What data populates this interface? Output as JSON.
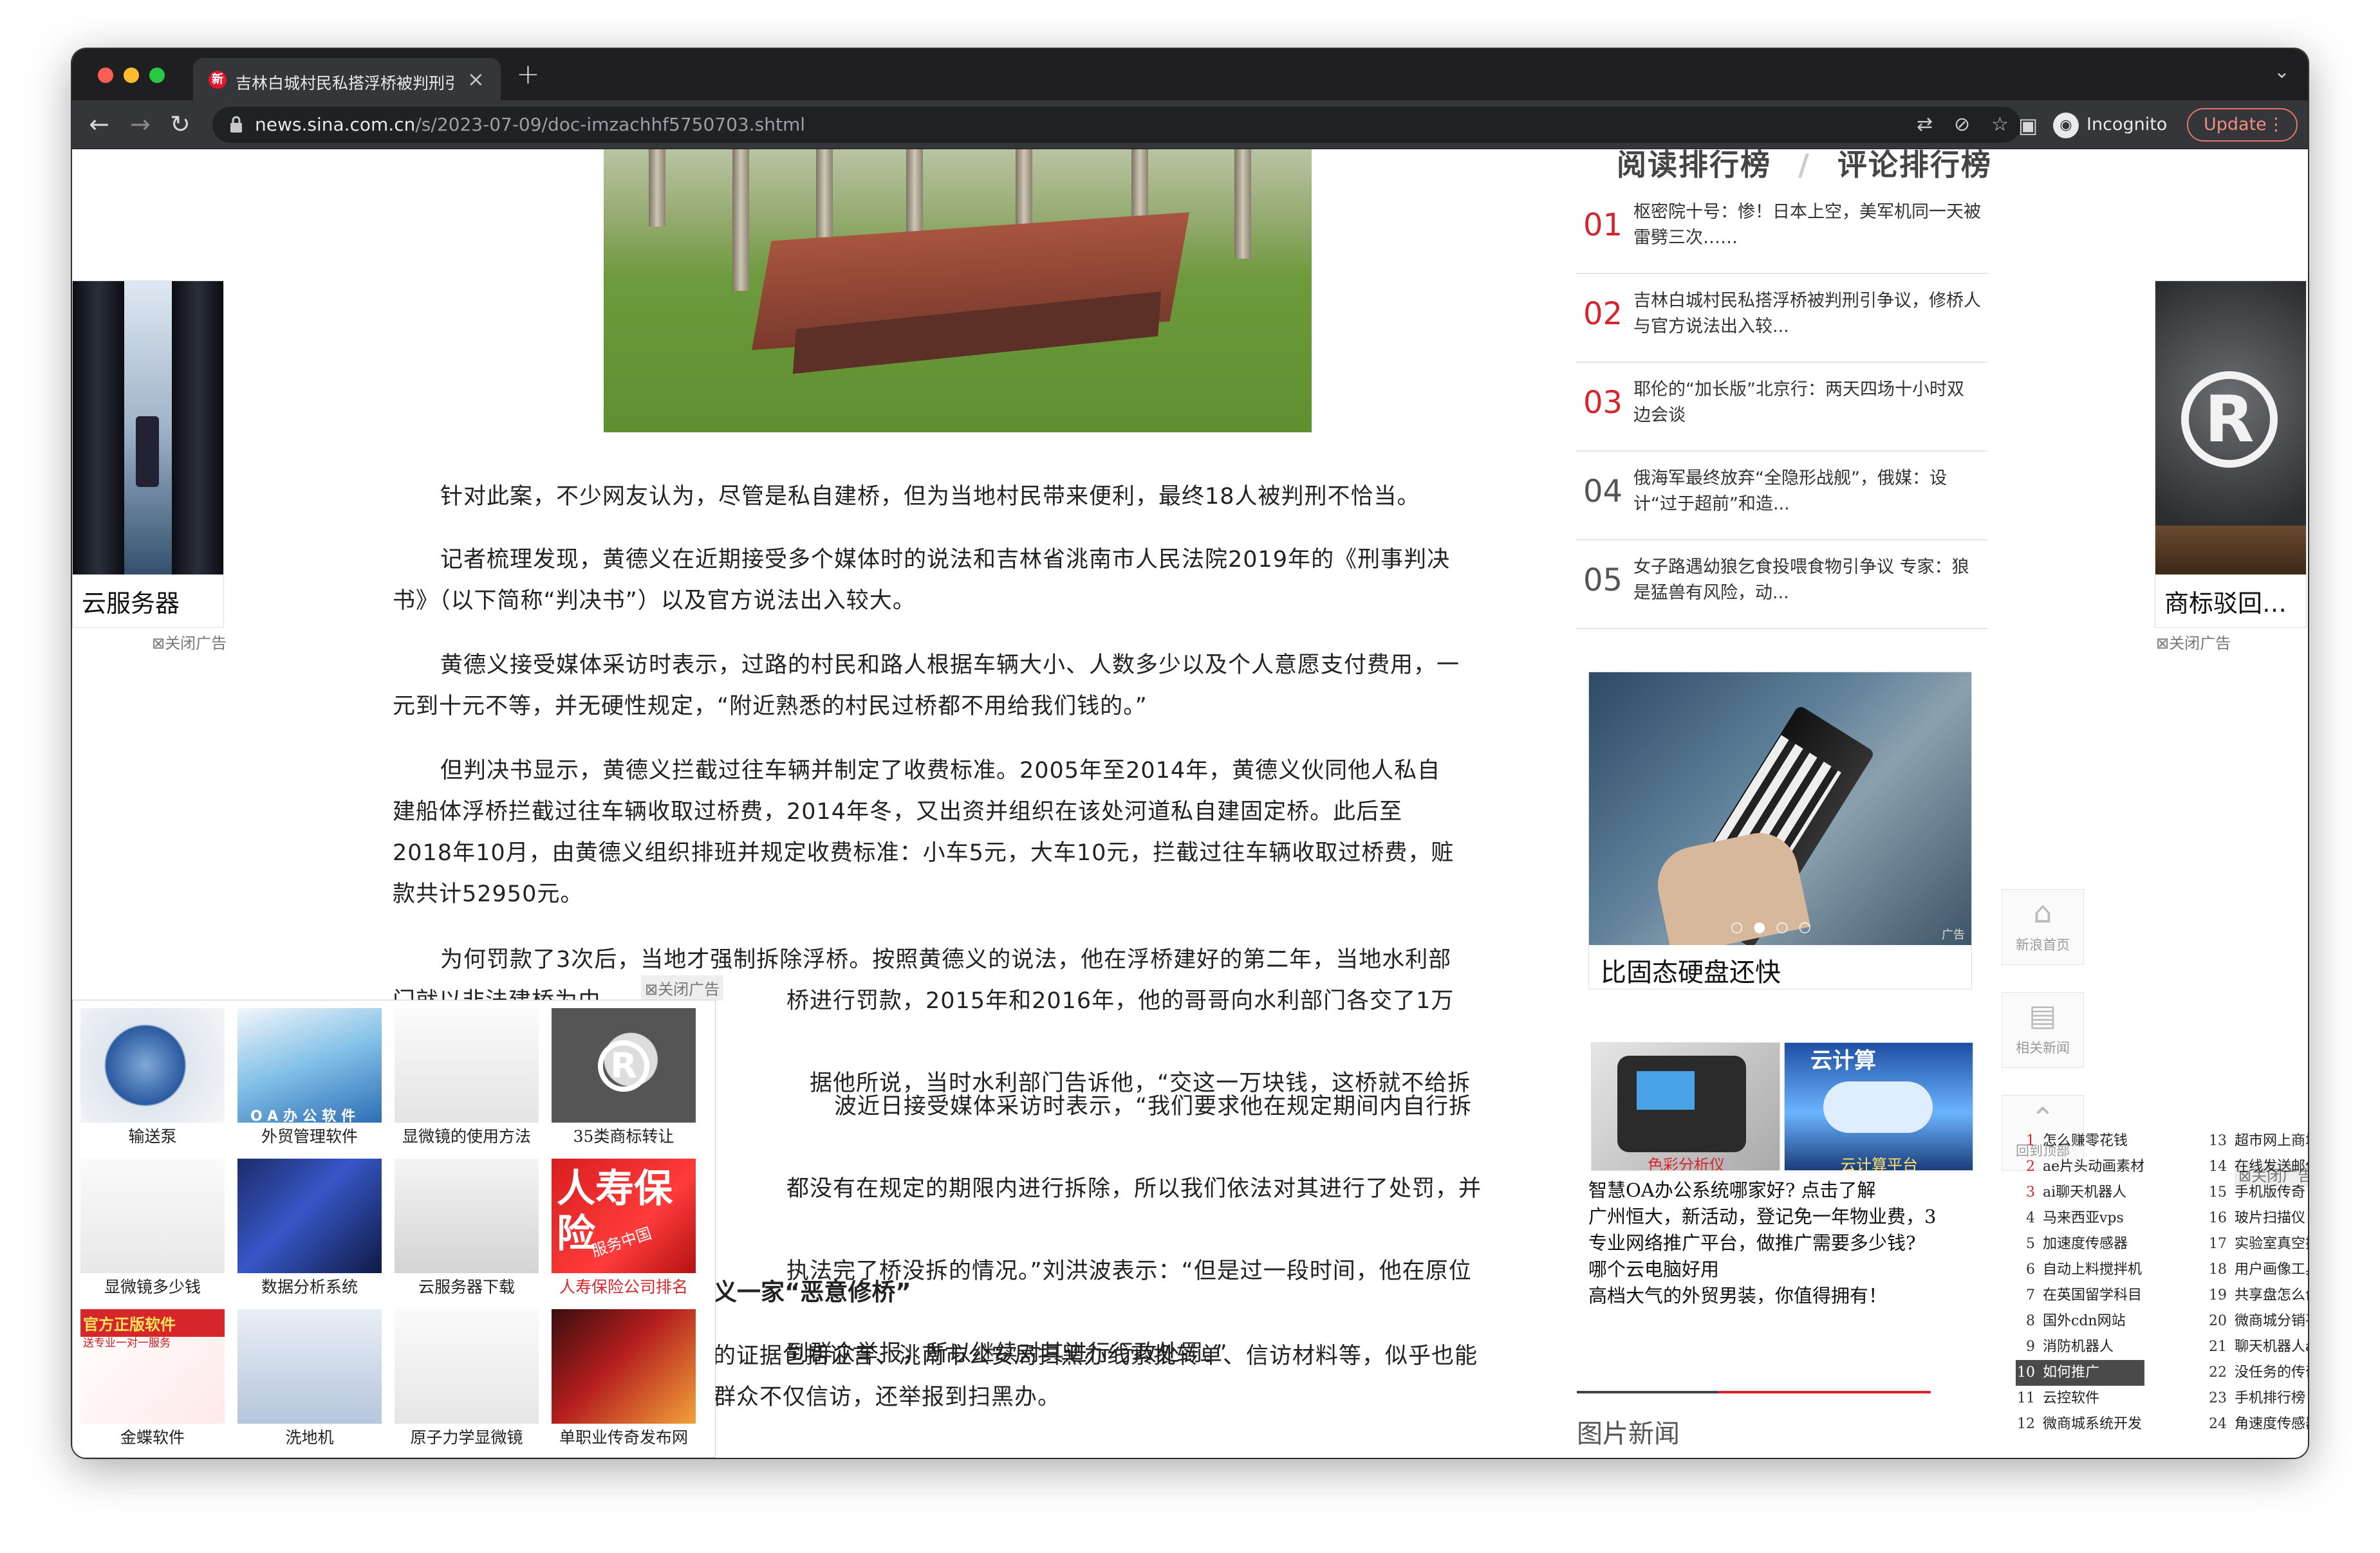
{
  "browser": {
    "tab_title": "吉林白城村民私搭浮桥被判刑引",
    "tab_icon_text": "新",
    "url_host": "news.sina.com.cn",
    "url_path": "/s/2023-07-09/doc-imzachhf5750703.shtml",
    "profile": "Incognito",
    "update_label": "Update",
    "icons": [
      "back-icon",
      "forward-icon",
      "reload-icon",
      "lock-icon",
      "translate-icon",
      "eye-off-icon",
      "star-icon",
      "sidepanel-icon",
      "incognito-icon",
      "more-icon"
    ]
  },
  "article": {
    "paragraphs": [
      [
        "针对此案，不少网友认为，尽管是私自建桥，但为当地村民带来便利，最终18人被判刑不恰当。"
      ],
      [
        "记者梳理发现，黄德义在近期接受多个媒体时的说法和吉林省洮南市人民法院2019年的《刑事判决",
        "书》（以下简称“判决书”）以及官方说法出入较大。"
      ],
      [
        "黄德义接受媒体采访时表示，过路的村民和路人根据车辆大小、人数多少以及个人意愿支付费用，一",
        "元到十元不等，并无硬性规定，“附近熟悉的村民过桥都不用给我们钱的。”"
      ],
      [
        "但判决书显示，黄德义拦截过往车辆并制定了收费标准。2005年至2014年，黄德义伙同他人私自",
        "建船体浮桥拦截过往车辆收取过桥费，2014年冬，又出资并组织在该处河道私自建固定桥。此后至",
        "2018年10月，由黄德义组织排班并规定收费标准：小车5元，大车10元，拦截过往车辆收取过桥费，赃",
        "款共计52950元。"
      ],
      [
        "为何罚款了3次后，当地才强制拆除浮桥。按照黄德义的说法，他在浮桥建好的第二年，当地水利部",
        "门就以非法建桥为由　　　　　　　　桥进行罚款，2015年和2016年，他的哥哥向水利部门各交了1万元。",
        "　　　　　　　　　　　　　　　　　　据他所说，当时水利部门告诉他，“交这一万块钱，这桥就不给拆了”。"
      ],
      [
        "　　　　　　　　　　　　　　　　　波近日接受媒体采访时表示，“我们要求他在规定期间内自行拆除违法建筑",
        "　　　　　　　　　　　　　　　　　都没有在规定的期限内进行拆除，所以我们依法对其进行了处罚，并且每次",
        "　　　　　　　　　　　　　　　　　执法完了桥没拆的情况。”刘洪波表示：“但是过一段时间，他在原位置上",
        "　　　　　　　　　　　　　　　　　到群众举报，所以继续对其进行行政处罚。”"
      ]
    ],
    "subheading": "义一家“恶意修桥”",
    "tail_lines": [
      "的证据包括证言、洮南市公安局扫黑办线索批转单、信访材料等，似乎也能",
      "群众不仅信访，还举报到扫黑办。"
    ]
  },
  "left_ad": {
    "caption": "云服务器",
    "close": "⊠关闭广告"
  },
  "right_ad": {
    "caption": "商标驳回…",
    "close": "⊠关闭广告"
  },
  "grid_ad": {
    "close": "⊠关闭广告",
    "items": [
      {
        "label": "输送泵"
      },
      {
        "label": "外贸管理软件"
      },
      {
        "label": "显微镜的使用方法"
      },
      {
        "label": "35类商标转让"
      },
      {
        "label": "显微镜多少钱"
      },
      {
        "label": "数据分析系统"
      },
      {
        "label": "云服务器下载"
      },
      {
        "label": "人寿保险公司排名"
      },
      {
        "label": "金蝶软件"
      },
      {
        "label": "洗地机"
      },
      {
        "label": "原子力学显微镜"
      },
      {
        "label": "单职业传奇发布网"
      }
    ],
    "oa_text": "OA办公软件",
    "insurance_text": "人寿保险",
    "insurance_sub": "服务中国",
    "kingdee_text": "官方正版软件",
    "kingdee_sub": "送专业一对一服务"
  },
  "ranking": {
    "tabs": [
      "阅读排行榜",
      "评论排行榜"
    ],
    "items": [
      {
        "num": "01",
        "text": "枢密院十号：惨！日本上空，美军机同一天被雷劈三次……"
      },
      {
        "num": "02",
        "text": "吉林白城村民私搭浮桥被判刑引争议，修桥人与官方说法出入较..."
      },
      {
        "num": "03",
        "text": "耶伦的“加长版”北京行：两天四场十小时双边会谈"
      },
      {
        "num": "04",
        "text": "俄海军最终放弃“全隐形战舰”，俄媒：设计“过于超前”和造..."
      },
      {
        "num": "05",
        "text": "女子路遇幼狼乞食投喂食物引争议 专家：狼是猛兽有风险，动..."
      }
    ]
  },
  "slide_ad": {
    "caption": "比固态硬盘还快",
    "tag": "广告"
  },
  "float_nav": [
    {
      "label": "新浪首页"
    },
    {
      "label": "相关新闻"
    },
    {
      "label": "回到顶部"
    }
  ],
  "bottom_ad": {
    "close": "⊠关闭广告",
    "img1_text": "色彩分析仪",
    "img2_text": "云计算",
    "img2_sub": "云计算平台",
    "lines": [
      "智慧OA办公系统哪家好? 点击了解",
      "广州恒大，新活动，登记免一年物业费，3",
      "专业网络推广平台，做推广需要多少钱?",
      "哪个云电脑好用",
      "高档大气的外贸男装，你值得拥有！"
    ],
    "list_a": [
      {
        "n": "1",
        "t": "怎么赚零花钱"
      },
      {
        "n": "2",
        "t": "ae片头动画素材"
      },
      {
        "n": "3",
        "t": "ai聊天机器人"
      },
      {
        "n": "4",
        "t": "马来西亚vps"
      },
      {
        "n": "5",
        "t": "加速度传感器"
      },
      {
        "n": "6",
        "t": "自动上料搅拌机"
      },
      {
        "n": "7",
        "t": "在英国留学科目"
      },
      {
        "n": "8",
        "t": "国外cdn网站"
      },
      {
        "n": "9",
        "t": "消防机器人"
      },
      {
        "n": "10",
        "t": "如何推广"
      },
      {
        "n": "11",
        "t": "云控软件"
      },
      {
        "n": "12",
        "t": "微商城系统开发"
      }
    ],
    "list_b": [
      {
        "n": "13",
        "t": "超市网上商城"
      },
      {
        "n": "14",
        "t": "在线发送邮件"
      },
      {
        "n": "15",
        "t": "手机版传奇"
      },
      {
        "n": "16",
        "t": "玻片扫描仪"
      },
      {
        "n": "17",
        "t": "实验室真空搅拌"
      },
      {
        "n": "18",
        "t": "用户画像工具"
      },
      {
        "n": "19",
        "t": "共享盘怎么创建"
      },
      {
        "n": "20",
        "t": "微商城分销平台"
      },
      {
        "n": "21",
        "t": "聊天机器人api"
      },
      {
        "n": "22",
        "t": "没任务的传奇"
      },
      {
        "n": "23",
        "t": "手机排行榜"
      },
      {
        "n": "24",
        "t": "角速度传感器"
      }
    ]
  },
  "section_title": "图片新闻"
}
